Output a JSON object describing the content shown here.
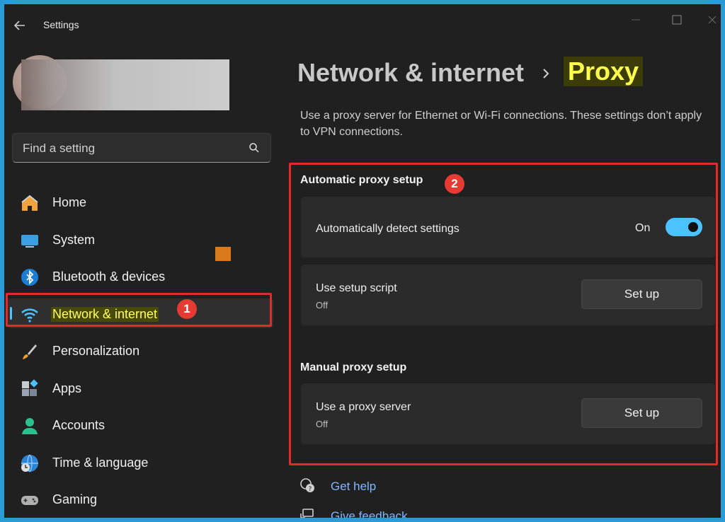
{
  "window": {
    "title": "Settings"
  },
  "user": {
    "name": "",
    "email": ""
  },
  "search": {
    "placeholder": "Find a setting"
  },
  "sidebar": {
    "items": [
      {
        "label": "Home",
        "icon": "home-icon"
      },
      {
        "label": "System",
        "icon": "system-icon"
      },
      {
        "label": "Bluetooth & devices",
        "icon": "bluetooth-icon"
      },
      {
        "label": "Network & internet",
        "icon": "wifi-icon",
        "selected": true
      },
      {
        "label": "Personalization",
        "icon": "brush-icon"
      },
      {
        "label": "Apps",
        "icon": "apps-icon"
      },
      {
        "label": "Accounts",
        "icon": "accounts-icon"
      },
      {
        "label": "Time & language",
        "icon": "globe-clock-icon"
      },
      {
        "label": "Gaming",
        "icon": "gamepad-icon"
      }
    ]
  },
  "breadcrumb": {
    "parent": "Network & internet",
    "current": "Proxy"
  },
  "description": "Use a proxy server for Ethernet or Wi-Fi connections. These settings don’t apply to VPN connections.",
  "automatic": {
    "heading": "Automatic proxy setup",
    "detect": {
      "title": "Automatically detect settings",
      "state_label": "On",
      "enabled": true
    },
    "script": {
      "title": "Use setup script",
      "status": "Off",
      "button": "Set up"
    }
  },
  "manual": {
    "heading": "Manual proxy setup",
    "server": {
      "title": "Use a proxy server",
      "status": "Off",
      "button": "Set up"
    }
  },
  "links": {
    "help": "Get help",
    "feedback": "Give feedback"
  },
  "annotations": {
    "badge1": "1",
    "badge2": "2"
  },
  "colors": {
    "accent": "#4cc2ff",
    "highlight_border": "#e02b2b",
    "badge": "#e63b32",
    "highlight_text": "#ffff66"
  }
}
